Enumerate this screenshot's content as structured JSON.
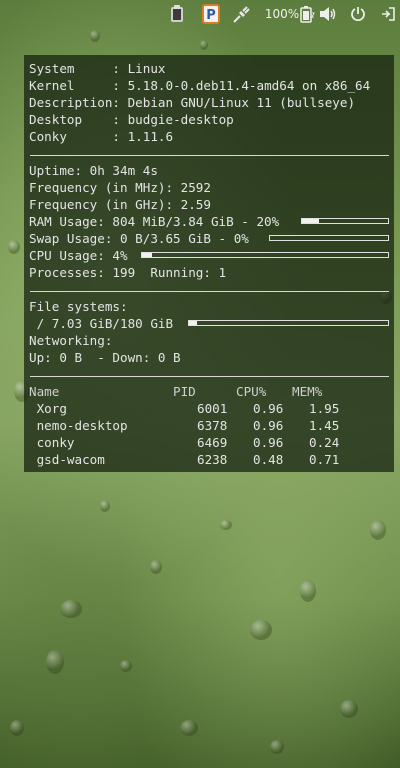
{
  "panel": {
    "icons": [
      "clipboard-icon",
      "parking-icon",
      "network-plug-icon",
      "volume-icon",
      "battery-icon",
      "power-icon",
      "logout-icon"
    ],
    "battery_text": "100%"
  },
  "system": {
    "system_label": "System     :",
    "system_value": "Linux",
    "kernel_label": "Kernel     :",
    "kernel_value": "5.18.0-0.deb11.4-amd64 on x86_64",
    "description_label": "Description:",
    "description_value": "Debian GNU/Linux 11 (bullseye)",
    "desktop_label": "Desktop    :",
    "desktop_value": "budgie-desktop",
    "conky_label": "Conky      :",
    "conky_value": "1.11.6"
  },
  "stats": {
    "uptime": "Uptime: 0h 34m 4s",
    "freq_mhz": "Frequency (in MHz): 2592",
    "freq_ghz": "Frequency (in GHz): 2.59",
    "ram": "RAM Usage: 804 MiB/3.84 GiB - 20%",
    "ram_fraction": 0.2,
    "swap": "Swap Usage: 0 B/3.65 GiB - 0%",
    "swap_fraction": 0.0,
    "cpu": "CPU Usage: 4%",
    "cpu_fraction": 0.04,
    "processes": "Processes: 199  Running: 1"
  },
  "fs": {
    "heading": "File systems:",
    "root": " / 7.03 GiB/180 GiB",
    "root_fraction": 0.04,
    "net_heading": "Networking:",
    "net": "Up: 0 B  - Down: 0 B"
  },
  "processes": {
    "headers": [
      "Name",
      "PID",
      "CPU%",
      "MEM%"
    ],
    "rows": [
      {
        "name": " Xorg",
        "pid": "6001",
        "cpu": "0.96",
        "mem": "1.95"
      },
      {
        "name": " nemo-desktop",
        "pid": "6378",
        "cpu": "0.96",
        "mem": "1.45"
      },
      {
        "name": " conky",
        "pid": "6469",
        "cpu": "0.96",
        "mem": "0.24"
      },
      {
        "name": " gsd-wacom",
        "pid": "6238",
        "cpu": "0.48",
        "mem": "0.71"
      }
    ]
  }
}
